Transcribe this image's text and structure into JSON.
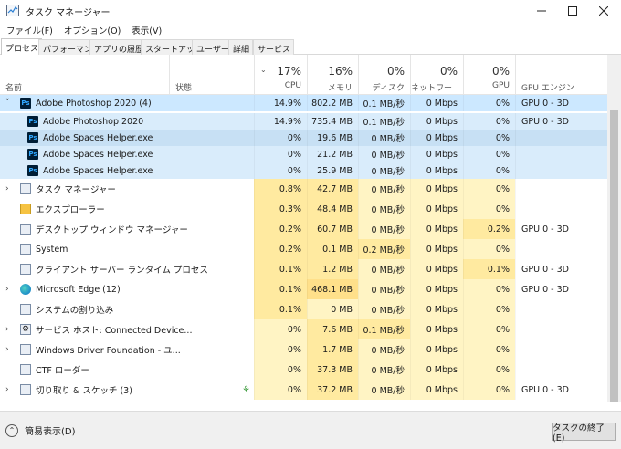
{
  "window": {
    "title": "タスク マネージャー"
  },
  "menu": [
    "ファイル(F)",
    "オプション(O)",
    "表示(V)"
  ],
  "tabs": [
    "プロセス",
    "パフォーマンス",
    "アプリの履歴",
    "スタートアップ",
    "ユーザー",
    "詳細",
    "サービス"
  ],
  "header": {
    "name": "名前",
    "status": "状態",
    "cpu": {
      "pct": "17%",
      "label": "CPU"
    },
    "memory": {
      "pct": "16%",
      "label": "メモリ"
    },
    "disk": {
      "pct": "0%",
      "label": "ディスク"
    },
    "network": {
      "pct": "0%",
      "label": "ネットワーク"
    },
    "gpu": {
      "pct": "0%",
      "label": "GPU"
    },
    "gpu_engine": {
      "label": "GPU エンジン"
    }
  },
  "rows": [
    {
      "name": "Adobe Photoshop 2020 (4)",
      "icon": "photoshop-icon",
      "expanded": true,
      "cpu": "14.9%",
      "mem": "802.2 MB",
      "disk": "0.1 MB/秒",
      "net": "0 Mbps",
      "gpu": "0%",
      "engine": "GPU 0 - 3D"
    },
    {
      "name": "Adobe Photoshop 2020",
      "icon": "photoshop-icon",
      "child": true,
      "cpu": "14.9%",
      "mem": "735.4 MB",
      "disk": "0.1 MB/秒",
      "net": "0 Mbps",
      "gpu": "0%",
      "engine": "GPU 0 - 3D"
    },
    {
      "name": "Adobe Spaces Helper.exe",
      "icon": "photoshop-icon",
      "child": true,
      "cpu": "0%",
      "mem": "19.6 MB",
      "disk": "0 MB/秒",
      "net": "0 Mbps",
      "gpu": "0%",
      "engine": ""
    },
    {
      "name": "Adobe Spaces Helper.exe",
      "icon": "photoshop-icon",
      "child": true,
      "cpu": "0%",
      "mem": "21.2 MB",
      "disk": "0 MB/秒",
      "net": "0 Mbps",
      "gpu": "0%",
      "engine": ""
    },
    {
      "name": "Adobe Spaces Helper.exe",
      "icon": "photoshop-icon",
      "child": true,
      "cpu": "0%",
      "mem": "25.9 MB",
      "disk": "0 MB/秒",
      "net": "0 Mbps",
      "gpu": "0%",
      "engine": ""
    },
    {
      "name": "タスク マネージャー",
      "icon": "task-manager-icon",
      "expandable": true,
      "cpu": "0.8%",
      "mem": "42.7 MB",
      "disk": "0 MB/秒",
      "net": "0 Mbps",
      "gpu": "0%",
      "engine": ""
    },
    {
      "name": "エクスプローラー",
      "icon": "folder-icon",
      "cpu": "0.3%",
      "mem": "48.4 MB",
      "disk": "0 MB/秒",
      "net": "0 Mbps",
      "gpu": "0%",
      "engine": ""
    },
    {
      "name": "デスクトップ ウィンドウ マネージャー",
      "icon": "window-icon",
      "cpu": "0.2%",
      "mem": "60.7 MB",
      "disk": "0 MB/秒",
      "net": "0 Mbps",
      "gpu": "0.2%",
      "engine": "GPU 0 - 3D"
    },
    {
      "name": "System",
      "icon": "system-icon",
      "cpu": "0.2%",
      "mem": "0.1 MB",
      "disk": "0.2 MB/秒",
      "net": "0 Mbps",
      "gpu": "0%",
      "engine": ""
    },
    {
      "name": "クライアント サーバー ランタイム プロセス",
      "icon": "process-icon",
      "cpu": "0.1%",
      "mem": "1.2 MB",
      "disk": "0 MB/秒",
      "net": "0 Mbps",
      "gpu": "0.1%",
      "engine": "GPU 0 - 3D"
    },
    {
      "name": "Microsoft Edge (12)",
      "icon": "edge-icon",
      "expandable": true,
      "cpu": "0.1%",
      "mem": "468.1 MB",
      "disk": "0 MB/秒",
      "net": "0 Mbps",
      "gpu": "0%",
      "engine": "GPU 0 - 3D"
    },
    {
      "name": "システムの割り込み",
      "icon": "interrupt-icon",
      "cpu": "0.1%",
      "mem": "0 MB",
      "disk": "0 MB/秒",
      "net": "0 Mbps",
      "gpu": "0%",
      "engine": ""
    },
    {
      "name": "サービス ホスト: Connected Device...",
      "icon": "gear-icon",
      "expandable": true,
      "cpu": "0%",
      "mem": "7.6 MB",
      "disk": "0.1 MB/秒",
      "net": "0 Mbps",
      "gpu": "0%",
      "engine": ""
    },
    {
      "name": "Windows Driver Foundation - ユ...",
      "icon": "driver-icon",
      "expandable": true,
      "cpu": "0%",
      "mem": "1.7 MB",
      "disk": "0 MB/秒",
      "net": "0 Mbps",
      "gpu": "0%",
      "engine": ""
    },
    {
      "name": "CTF ローダー",
      "icon": "ctf-icon",
      "cpu": "0%",
      "mem": "37.3 MB",
      "disk": "0 MB/秒",
      "net": "0 Mbps",
      "gpu": "0%",
      "engine": ""
    },
    {
      "name": "切り取り & スケッチ (3)",
      "icon": "snip-icon",
      "expandable": true,
      "suspended": true,
      "cpu": "0%",
      "mem": "37.2 MB",
      "disk": "0 MB/秒",
      "net": "0 Mbps",
      "gpu": "0%",
      "engine": "GPU 0 - 3D"
    }
  ],
  "footer": {
    "fewer_details": "簡易表示(D)",
    "end_task": "タスクの終了(E)"
  },
  "colors": {
    "selected": "#cce8ff",
    "selected_child": "#d9ecfb",
    "highlight_row": "#c7e0f4",
    "heat_light": "#fff4c4",
    "heat_mid": "#ffeaa0",
    "heat_strong": "#ffe08a"
  }
}
